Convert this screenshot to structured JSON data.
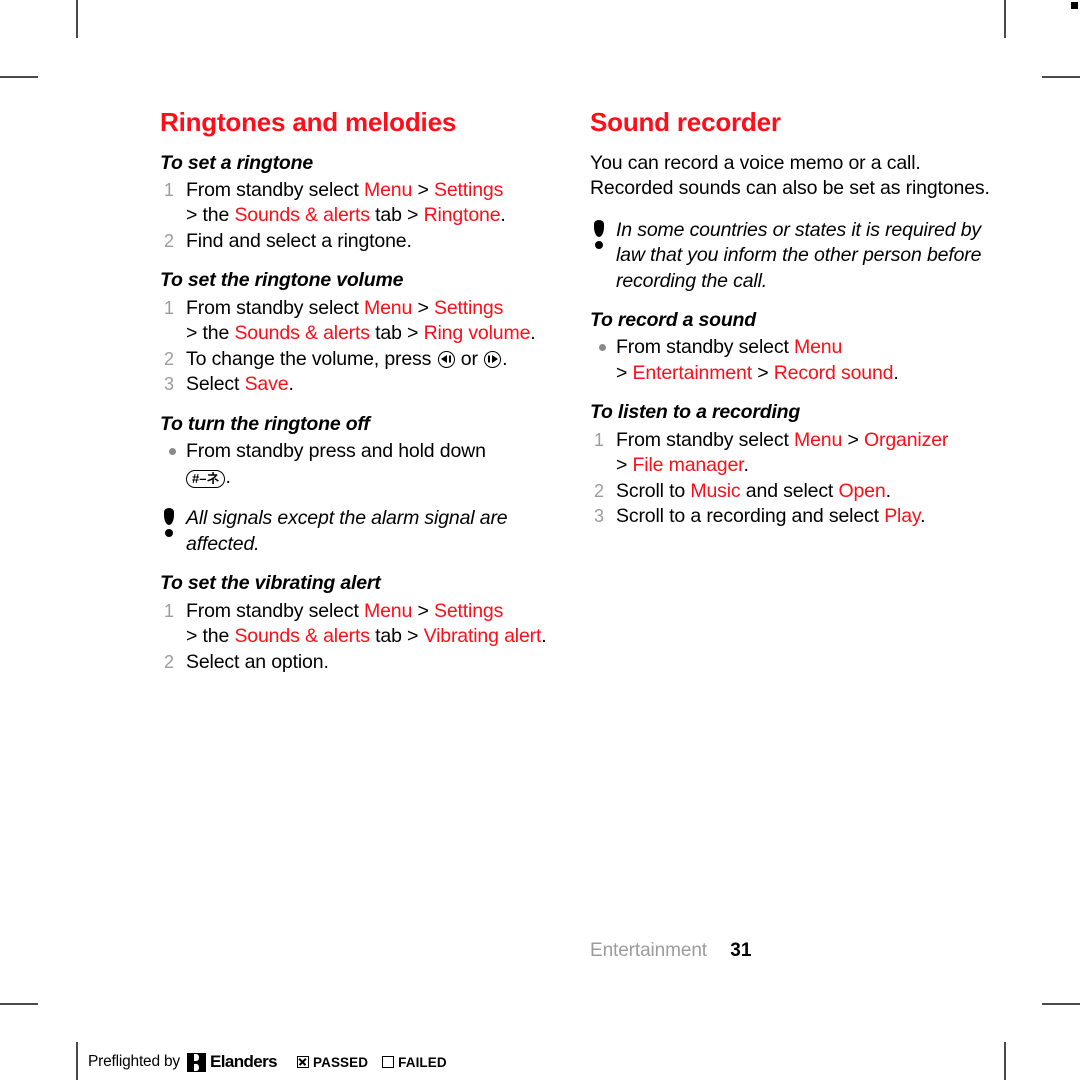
{
  "document": {
    "type": "phone-user-guide-page",
    "accent_color": "#ff0d18",
    "muted_color": "#9c9c9c"
  },
  "left_column": {
    "section_title": "Ringtones and melodies",
    "procedures": [
      {
        "title": "To set a ringtone",
        "list_type": "ordered",
        "steps": [
          {
            "number": "1",
            "parts": [
              {
                "t": "From standby select ",
                "c": "black"
              },
              {
                "t": "Menu",
                "c": "red"
              },
              {
                "t": " > ",
                "c": "black"
              },
              {
                "t": "Settings",
                "c": "red"
              },
              {
                "t": " > the ",
                "c": "black"
              },
              {
                "t": "Sounds & alerts",
                "c": "red"
              },
              {
                "t": " tab > ",
                "c": "black"
              },
              {
                "t": "Ringtone",
                "c": "red"
              },
              {
                "t": ".",
                "c": "black"
              }
            ]
          },
          {
            "number": "2",
            "parts": [
              {
                "t": "Find and select a ringtone.",
                "c": "black"
              }
            ]
          }
        ]
      },
      {
        "title": "To set the ringtone volume",
        "list_type": "ordered",
        "steps": [
          {
            "number": "1",
            "parts": [
              {
                "t": "From standby select ",
                "c": "black"
              },
              {
                "t": "Menu",
                "c": "red"
              },
              {
                "t": " > ",
                "c": "black"
              },
              {
                "t": "Settings",
                "c": "red"
              },
              {
                "t": " > the ",
                "c": "black"
              },
              {
                "t": "Sounds & alerts",
                "c": "red"
              },
              {
                "t": " tab > ",
                "c": "black"
              },
              {
                "t": "Ring volume",
                "c": "red"
              },
              {
                "t": ".",
                "c": "black"
              }
            ]
          },
          {
            "number": "2",
            "parts": [
              {
                "t": "To change the volume, press ",
                "c": "black"
              },
              {
                "t": "",
                "c": "icon-nav-left"
              },
              {
                "t": " or ",
                "c": "black"
              },
              {
                "t": "",
                "c": "icon-nav-right"
              },
              {
                "t": ".",
                "c": "black"
              }
            ]
          },
          {
            "number": "3",
            "parts": [
              {
                "t": "Select ",
                "c": "black"
              },
              {
                "t": "Save",
                "c": "red"
              },
              {
                "t": ".",
                "c": "black"
              }
            ]
          }
        ]
      },
      {
        "title": "To turn the ringtone off",
        "list_type": "bullet",
        "steps": [
          {
            "number": "•",
            "parts": [
              {
                "t": "From standby press and hold down ",
                "c": "black"
              },
              {
                "t": "#–ネ",
                "c": "key-hash"
              },
              {
                "t": ".",
                "c": "black"
              }
            ]
          }
        ]
      }
    ],
    "note": "All signals except the alarm signal are affected.",
    "procedures_after_note": [
      {
        "title": "To set the vibrating alert",
        "list_type": "ordered",
        "steps": [
          {
            "number": "1",
            "parts": [
              {
                "t": "From standby select ",
                "c": "black"
              },
              {
                "t": "Menu",
                "c": "red"
              },
              {
                "t": " > ",
                "c": "black"
              },
              {
                "t": "Settings",
                "c": "red"
              },
              {
                "t": " > the ",
                "c": "black"
              },
              {
                "t": "Sounds & alerts",
                "c": "red"
              },
              {
                "t": " tab > ",
                "c": "black"
              },
              {
                "t": "Vibrating alert",
                "c": "red"
              },
              {
                "t": ".",
                "c": "black"
              }
            ]
          },
          {
            "number": "2",
            "parts": [
              {
                "t": "Select an option.",
                "c": "black"
              }
            ]
          }
        ]
      }
    ]
  },
  "right_column": {
    "section_title": "Sound recorder",
    "intro": "You can record a voice memo or a call. Recorded sounds can also be set as ringtones.",
    "note": "In some countries or states it is required by law that you inform the other person before recording the call.",
    "procedures": [
      {
        "title": "To record a sound",
        "list_type": "bullet",
        "steps": [
          {
            "number": "•",
            "parts": [
              {
                "t": "From standby select ",
                "c": "black"
              },
              {
                "t": "Menu",
                "c": "red"
              },
              {
                "t": " > ",
                "c": "black"
              },
              {
                "t": "Entertainment",
                "c": "red"
              },
              {
                "t": " > ",
                "c": "black"
              },
              {
                "t": "Record sound",
                "c": "red"
              },
              {
                "t": ".",
                "c": "black"
              }
            ]
          }
        ]
      },
      {
        "title": "To listen to a recording",
        "list_type": "ordered",
        "steps": [
          {
            "number": "1",
            "parts": [
              {
                "t": "From standby select ",
                "c": "black"
              },
              {
                "t": "Menu",
                "c": "red"
              },
              {
                "t": " > ",
                "c": "black"
              },
              {
                "t": "Organizer",
                "c": "red"
              },
              {
                "t": " > ",
                "c": "black"
              },
              {
                "t": "File manager",
                "c": "red"
              },
              {
                "t": ".",
                "c": "black"
              }
            ]
          },
          {
            "number": "2",
            "parts": [
              {
                "t": "Scroll to ",
                "c": "black"
              },
              {
                "t": "Music",
                "c": "red"
              },
              {
                "t": " and select ",
                "c": "black"
              },
              {
                "t": "Open",
                "c": "red"
              },
              {
                "t": ".",
                "c": "black"
              }
            ]
          },
          {
            "number": "3",
            "parts": [
              {
                "t": "Scroll to a recording and select ",
                "c": "black"
              },
              {
                "t": "Play",
                "c": "red"
              },
              {
                "t": ".",
                "c": "black"
              }
            ]
          }
        ]
      }
    ]
  },
  "footer": {
    "chapter": "Entertainment",
    "page_number": "31"
  },
  "preflight_bar": {
    "lead_text": "Preflighted by",
    "brand": "Elanders",
    "passed_label": "PASSED",
    "passed_checked": true,
    "failed_label": "FAILED",
    "failed_checked": false
  }
}
